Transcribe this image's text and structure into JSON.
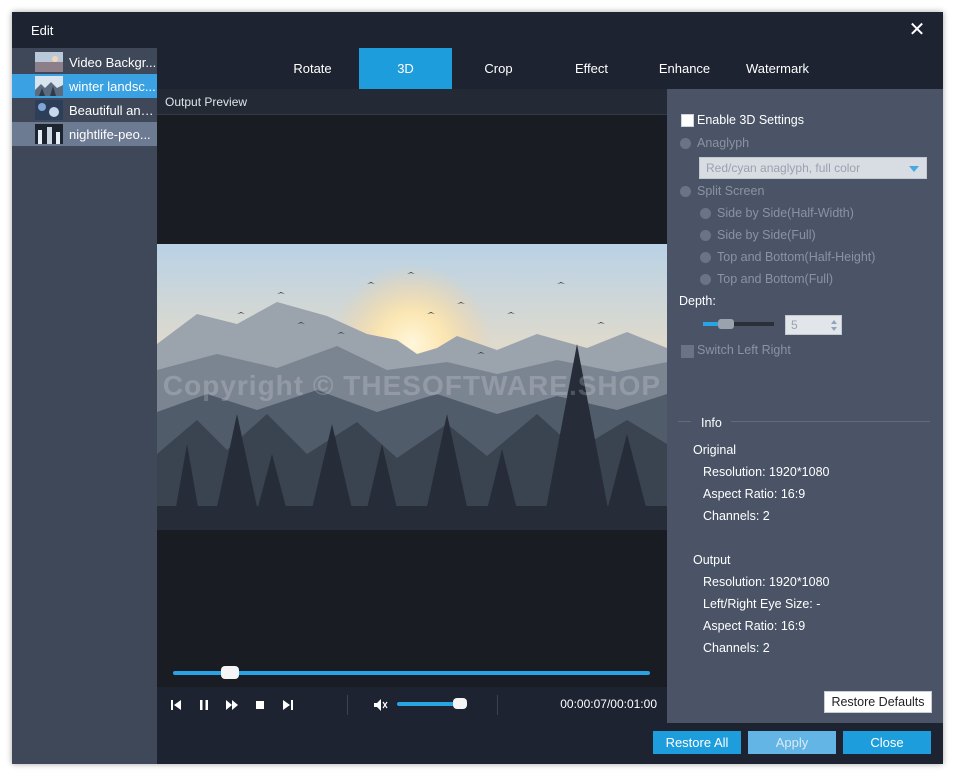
{
  "window": {
    "title": "Edit"
  },
  "files": [
    {
      "name": "Video Backgr...",
      "state": "normal"
    },
    {
      "name": "winter landsc...",
      "state": "active"
    },
    {
      "name": "Beautifull and...",
      "state": "normal"
    },
    {
      "name": "nightlife-peo...",
      "state": "selected"
    }
  ],
  "tabs": [
    "Rotate",
    "3D",
    "Crop",
    "Effect",
    "Enhance",
    "Watermark"
  ],
  "active_tab": "3D",
  "preview": {
    "heading": "Output Preview",
    "watermark": "Copyright © THESOFTWARE.SHOP",
    "timecode": "00:00:07/00:01:00",
    "progress": 0.12,
    "volume": 0.9
  },
  "settings": {
    "enable_3d": "Enable 3D Settings",
    "anaglyph": "Anaglyph",
    "anaglyph_select": "Red/cyan anaglyph, full color",
    "split_screen": "Split Screen",
    "split_options": [
      "Side by Side(Half-Width)",
      "Side by Side(Full)",
      "Top and Bottom(Half-Height)",
      "Top and Bottom(Full)"
    ],
    "depth_label": "Depth:",
    "depth_value": "5",
    "switch_left_right": "Switch Left Right"
  },
  "info": {
    "heading": "Info",
    "original_heading": "Original",
    "original": [
      "Resolution: 1920*1080",
      "Aspect Ratio: 16:9",
      "Channels: 2"
    ],
    "output_heading": "Output",
    "output": [
      "Resolution: 1920*1080",
      "Left/Right Eye Size: -",
      "Aspect Ratio: 16:9",
      "Channels: 2"
    ]
  },
  "buttons": {
    "restore_defaults": "Restore Defaults",
    "restore_all": "Restore All",
    "apply": "Apply",
    "close": "Close"
  },
  "colors": {
    "accent": "#1e9ddc",
    "titlebar": "#1d2330",
    "panel": "#4a5466"
  }
}
